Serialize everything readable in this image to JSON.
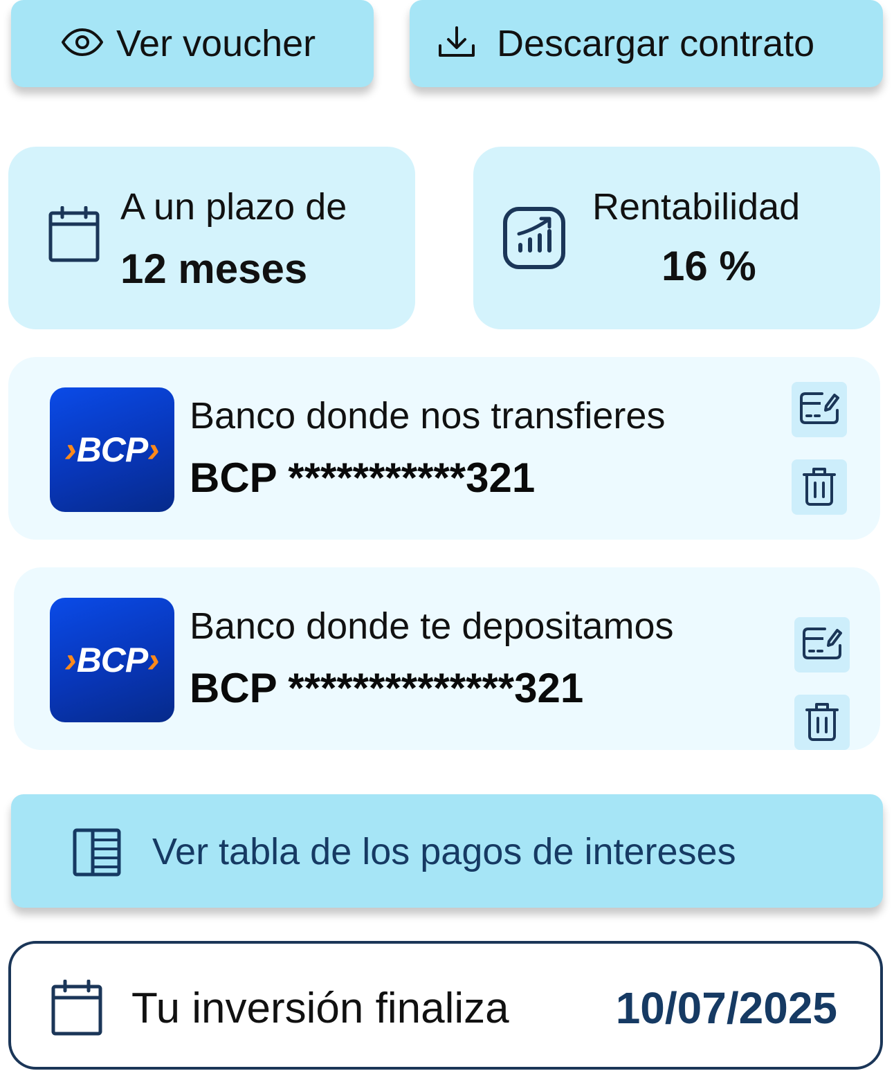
{
  "actions": {
    "voucher_label": "Ver voucher",
    "contract_label": "Descargar contrato",
    "table_label": "Ver tabla de los pagos de intereses"
  },
  "term": {
    "label": "A un plazo de",
    "value": "12 meses"
  },
  "return": {
    "label": "Rentabilidad",
    "value": "16 %"
  },
  "banks": [
    {
      "title": "Banco donde nos transfieres",
      "account": "BCP ***********321",
      "logo_text": "BCP"
    },
    {
      "title": "Banco donde te depositamos",
      "account": "BCP **************321",
      "logo_text": "BCP"
    }
  ],
  "end": {
    "label": "Tu inversión finaliza",
    "date": "10/07/2025"
  },
  "colors": {
    "button_bg": "#a6e5f6",
    "stat_bg": "#d4f3fc",
    "bank_bg": "#edfaff",
    "accent_dark": "#163a63",
    "bcp_blue": "#0836b8",
    "bcp_orange": "#ff8a1a"
  }
}
